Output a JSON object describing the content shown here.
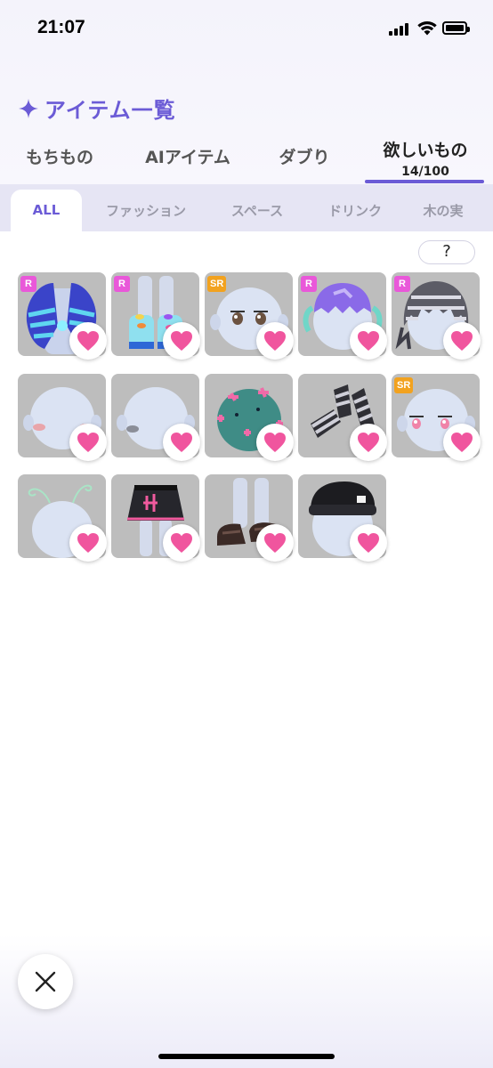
{
  "status_bar": {
    "time": "21:07"
  },
  "header": {
    "title": "アイテム一覧"
  },
  "tabs": [
    {
      "label": "もちもの"
    },
    {
      "label": "AIアイテム"
    },
    {
      "label": "ダブり"
    },
    {
      "label": "欲しいもの",
      "count": "14/100",
      "active": true
    }
  ],
  "subtabs": [
    {
      "label": "ALL",
      "active": true
    },
    {
      "label": "ファッション"
    },
    {
      "label": "スペース"
    },
    {
      "label": "ドリンク"
    },
    {
      "label": "木の実"
    }
  ],
  "help_button": {
    "label": "?"
  },
  "items": [
    {
      "rarity": "R",
      "kind": "striped-jacket"
    },
    {
      "rarity": "R",
      "kind": "aquarium-boots"
    },
    {
      "rarity": "SR",
      "kind": "face-eyes"
    },
    {
      "rarity": "R",
      "kind": "purple-hair"
    },
    {
      "rarity": "R",
      "kind": "silver-hair"
    },
    {
      "rarity": "",
      "kind": "blush-face"
    },
    {
      "rarity": "",
      "kind": "shadow-face"
    },
    {
      "rarity": "",
      "kind": "spiky-helmet"
    },
    {
      "rarity": "",
      "kind": "striped-gloves"
    },
    {
      "rarity": "SR",
      "kind": "pink-eyes"
    },
    {
      "rarity": "",
      "kind": "antenna"
    },
    {
      "rarity": "",
      "kind": "black-skirt"
    },
    {
      "rarity": "",
      "kind": "loafers"
    },
    {
      "rarity": "",
      "kind": "black-beanie"
    }
  ],
  "colors": {
    "accent": "#6b5bd6",
    "heart": "#f0559e",
    "rarity_r": "#e958d9",
    "rarity_sr": "#f2a21f"
  }
}
